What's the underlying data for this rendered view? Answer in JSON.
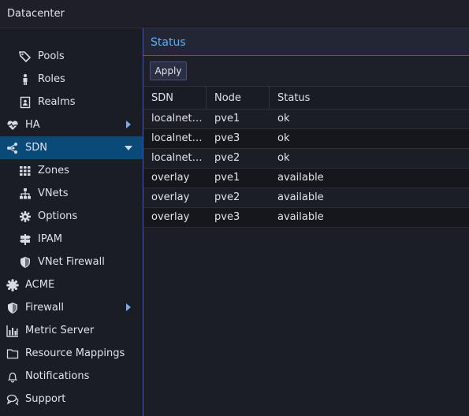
{
  "window": {
    "title": "Datacenter"
  },
  "sidebar": {
    "items": [
      {
        "id": "pools",
        "label": "Pools",
        "icon": "tags-icon",
        "level": 2
      },
      {
        "id": "roles",
        "label": "Roles",
        "icon": "person-icon",
        "level": 2
      },
      {
        "id": "realms",
        "label": "Realms",
        "icon": "address-book-icon",
        "level": 2
      },
      {
        "id": "ha",
        "label": "HA",
        "icon": "heartbeat-icon",
        "level": 1,
        "expander": "collapsed"
      },
      {
        "id": "sdn",
        "label": "SDN",
        "icon": "sdn-network-icon",
        "level": 1,
        "expander": "expanded",
        "selected": true
      },
      {
        "id": "zones",
        "label": "Zones",
        "icon": "grid-icon",
        "level": 2
      },
      {
        "id": "vnets",
        "label": "VNets",
        "icon": "sitemap-icon",
        "level": 2
      },
      {
        "id": "options",
        "label": "Options",
        "icon": "gear-icon",
        "level": 2
      },
      {
        "id": "ipam",
        "label": "IPAM",
        "icon": "signpost-icon",
        "level": 2
      },
      {
        "id": "vnet-firewall",
        "label": "VNet Firewall",
        "icon": "shield-icon",
        "level": 2
      },
      {
        "id": "acme",
        "label": "ACME",
        "icon": "certificate-icon",
        "level": 1
      },
      {
        "id": "firewall",
        "label": "Firewall",
        "icon": "shield-icon",
        "level": 1,
        "expander": "collapsed"
      },
      {
        "id": "metric-server",
        "label": "Metric Server",
        "icon": "bar-chart-icon",
        "level": 1
      },
      {
        "id": "resource-mappings",
        "label": "Resource Mappings",
        "icon": "folder-icon",
        "level": 1
      },
      {
        "id": "notifications",
        "label": "Notifications",
        "icon": "bell-icon",
        "level": 1
      },
      {
        "id": "support",
        "label": "Support",
        "icon": "comments-icon",
        "level": 1
      }
    ]
  },
  "panel": {
    "title": "Status",
    "apply_label": "Apply",
    "columns": [
      "SDN",
      "Node",
      "Status"
    ],
    "rows": [
      {
        "sdn": "localnet…",
        "node": "pve1",
        "status": "ok"
      },
      {
        "sdn": "localnet…",
        "node": "pve3",
        "status": "ok"
      },
      {
        "sdn": "localnet…",
        "node": "pve2",
        "status": "ok"
      },
      {
        "sdn": "overlay",
        "node": "pve1",
        "status": "available"
      },
      {
        "sdn": "overlay",
        "node": "pve2",
        "status": "available"
      },
      {
        "sdn": "overlay",
        "node": "pve3",
        "status": "available"
      }
    ]
  },
  "colors": {
    "accent": "#5eb0f5",
    "selected_bg": "#0a4a78",
    "border_accent": "#3a57c8"
  }
}
